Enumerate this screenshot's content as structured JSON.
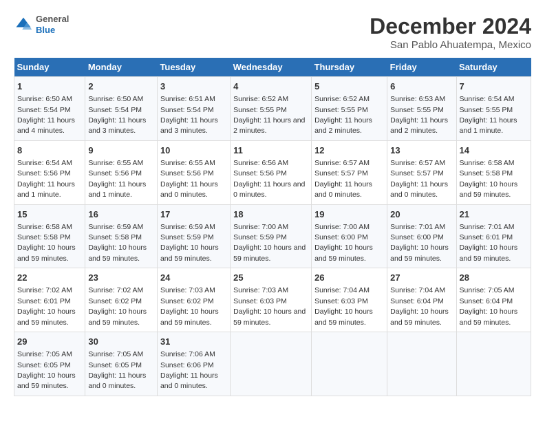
{
  "header": {
    "logo_general": "General",
    "logo_blue": "Blue",
    "title": "December 2024",
    "subtitle": "San Pablo Ahuatempa, Mexico"
  },
  "calendar": {
    "days_of_week": [
      "Sunday",
      "Monday",
      "Tuesday",
      "Wednesday",
      "Thursday",
      "Friday",
      "Saturday"
    ],
    "weeks": [
      [
        {
          "day": 1,
          "sunrise": "6:50 AM",
          "sunset": "5:54 PM",
          "daylight": "11 hours and 4 minutes."
        },
        {
          "day": 2,
          "sunrise": "6:50 AM",
          "sunset": "5:54 PM",
          "daylight": "11 hours and 3 minutes."
        },
        {
          "day": 3,
          "sunrise": "6:51 AM",
          "sunset": "5:54 PM",
          "daylight": "11 hours and 3 minutes."
        },
        {
          "day": 4,
          "sunrise": "6:52 AM",
          "sunset": "5:55 PM",
          "daylight": "11 hours and 2 minutes."
        },
        {
          "day": 5,
          "sunrise": "6:52 AM",
          "sunset": "5:55 PM",
          "daylight": "11 hours and 2 minutes."
        },
        {
          "day": 6,
          "sunrise": "6:53 AM",
          "sunset": "5:55 PM",
          "daylight": "11 hours and 2 minutes."
        },
        {
          "day": 7,
          "sunrise": "6:54 AM",
          "sunset": "5:55 PM",
          "daylight": "11 hours and 1 minute."
        }
      ],
      [
        {
          "day": 8,
          "sunrise": "6:54 AM",
          "sunset": "5:56 PM",
          "daylight": "11 hours and 1 minute."
        },
        {
          "day": 9,
          "sunrise": "6:55 AM",
          "sunset": "5:56 PM",
          "daylight": "11 hours and 1 minute."
        },
        {
          "day": 10,
          "sunrise": "6:55 AM",
          "sunset": "5:56 PM",
          "daylight": "11 hours and 0 minutes."
        },
        {
          "day": 11,
          "sunrise": "6:56 AM",
          "sunset": "5:56 PM",
          "daylight": "11 hours and 0 minutes."
        },
        {
          "day": 12,
          "sunrise": "6:57 AM",
          "sunset": "5:57 PM",
          "daylight": "11 hours and 0 minutes."
        },
        {
          "day": 13,
          "sunrise": "6:57 AM",
          "sunset": "5:57 PM",
          "daylight": "11 hours and 0 minutes."
        },
        {
          "day": 14,
          "sunrise": "6:58 AM",
          "sunset": "5:58 PM",
          "daylight": "10 hours and 59 minutes."
        }
      ],
      [
        {
          "day": 15,
          "sunrise": "6:58 AM",
          "sunset": "5:58 PM",
          "daylight": "10 hours and 59 minutes."
        },
        {
          "day": 16,
          "sunrise": "6:59 AM",
          "sunset": "5:58 PM",
          "daylight": "10 hours and 59 minutes."
        },
        {
          "day": 17,
          "sunrise": "6:59 AM",
          "sunset": "5:59 PM",
          "daylight": "10 hours and 59 minutes."
        },
        {
          "day": 18,
          "sunrise": "7:00 AM",
          "sunset": "5:59 PM",
          "daylight": "10 hours and 59 minutes."
        },
        {
          "day": 19,
          "sunrise": "7:00 AM",
          "sunset": "6:00 PM",
          "daylight": "10 hours and 59 minutes."
        },
        {
          "day": 20,
          "sunrise": "7:01 AM",
          "sunset": "6:00 PM",
          "daylight": "10 hours and 59 minutes."
        },
        {
          "day": 21,
          "sunrise": "7:01 AM",
          "sunset": "6:01 PM",
          "daylight": "10 hours and 59 minutes."
        }
      ],
      [
        {
          "day": 22,
          "sunrise": "7:02 AM",
          "sunset": "6:01 PM",
          "daylight": "10 hours and 59 minutes."
        },
        {
          "day": 23,
          "sunrise": "7:02 AM",
          "sunset": "6:02 PM",
          "daylight": "10 hours and 59 minutes."
        },
        {
          "day": 24,
          "sunrise": "7:03 AM",
          "sunset": "6:02 PM",
          "daylight": "10 hours and 59 minutes."
        },
        {
          "day": 25,
          "sunrise": "7:03 AM",
          "sunset": "6:03 PM",
          "daylight": "10 hours and 59 minutes."
        },
        {
          "day": 26,
          "sunrise": "7:04 AM",
          "sunset": "6:03 PM",
          "daylight": "10 hours and 59 minutes."
        },
        {
          "day": 27,
          "sunrise": "7:04 AM",
          "sunset": "6:04 PM",
          "daylight": "10 hours and 59 minutes."
        },
        {
          "day": 28,
          "sunrise": "7:05 AM",
          "sunset": "6:04 PM",
          "daylight": "10 hours and 59 minutes."
        }
      ],
      [
        {
          "day": 29,
          "sunrise": "7:05 AM",
          "sunset": "6:05 PM",
          "daylight": "10 hours and 59 minutes."
        },
        {
          "day": 30,
          "sunrise": "7:05 AM",
          "sunset": "6:05 PM",
          "daylight": "11 hours and 0 minutes."
        },
        {
          "day": 31,
          "sunrise": "7:06 AM",
          "sunset": "6:06 PM",
          "daylight": "11 hours and 0 minutes."
        },
        null,
        null,
        null,
        null
      ]
    ]
  }
}
